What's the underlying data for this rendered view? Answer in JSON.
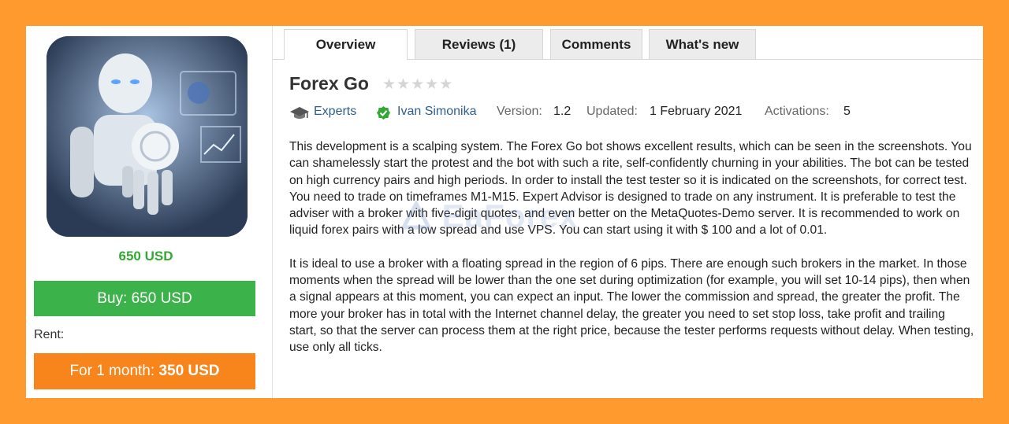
{
  "product": {
    "price": "650 USD",
    "buy_label": "Buy: 650 USD",
    "rent_label": "Rent:",
    "rent_button": {
      "period": "For 1 month:",
      "price": "350 USD"
    }
  },
  "tabs": [
    {
      "label": "Overview",
      "active": true
    },
    {
      "label": "Reviews (1)",
      "active": false
    },
    {
      "label": "Comments",
      "active": false
    },
    {
      "label": "What's new",
      "active": false
    }
  ],
  "header": {
    "title": "Forex Go",
    "rating_stars": "★★★★★",
    "rating_value": 0
  },
  "meta": {
    "category": "Experts",
    "author": "Ivan Simonika",
    "version_label": "Version:",
    "version": "1.2",
    "updated_label": "Updated:",
    "updated": "1 February 2021",
    "activations_label": "Activations:",
    "activations": "5"
  },
  "description": [
    "This development is a scalping system. The Forex Go bot shows excellent results, which can be seen in the screenshots. You can shamelessly start the protest and the bot with such a rite, self-confidently churning in your abilities. The bot can be tested on high currency pairs and high periods. In order to install the test tester so it is indicated on the screenshots, for correct test. You need to trade on timeframes M1-M15. Expert Advisor is designed to trade on any instrument. It is preferable to test the adviser with a broker with five-digit quotes, and even better on the MetaQuotes-Demo server. It is recommended to work on liquid forex pairs with a low spread and use VPS. You can start using it with $ 100 and a lot of 0.01.",
    "It is ideal to use a broker with a floating spread in the region of 6 pips. There are enough such brokers in the market. In those moments when the spread will be lower than the one set during optimization (for example, you will set 10-14 pips), then when a signal appears at this moment, you can expect an input. The lower the commission and spread, the greater the profit. The more your broker has in total with the Internet channel delay, the greater you need to set stop loss, take profit and trailing start, so that the server can process them at the right price, because the tester performs requests without delay. When testing, use only all ticks."
  ],
  "watermark": "EaForex",
  "colors": {
    "frame": "#ff9a2e",
    "buy": "#3cb34a",
    "rent": "#f7851c",
    "price": "#33a833",
    "link": "#2e5f8c"
  }
}
